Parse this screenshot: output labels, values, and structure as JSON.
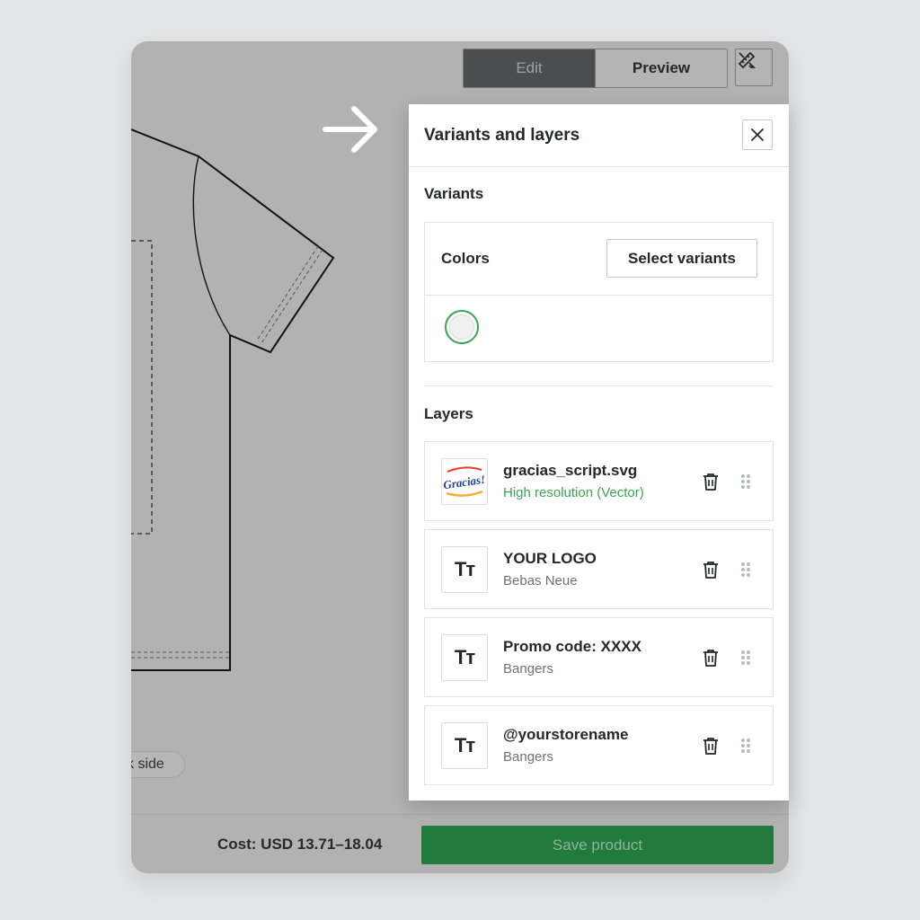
{
  "toolbar": {
    "edit_label": "Edit",
    "preview_label": "Preview",
    "tool_icon": "ruler-pencil-icon"
  },
  "canvas": {
    "side_toggle_label": "k side"
  },
  "footer": {
    "cost_label": "Cost: USD 13.71–18.04",
    "save_label": "Save product"
  },
  "panel": {
    "title": "Variants and layers",
    "variants": {
      "heading": "Variants",
      "colors_label": "Colors",
      "select_button": "Select variants",
      "selected_color": "#f1f1f1"
    },
    "layers": {
      "heading": "Layers",
      "items": [
        {
          "name": "gracias_script.svg",
          "sub": "High resolution (Vector)",
          "type": "image",
          "thumb_text": "Gracias!"
        },
        {
          "name": "YOUR LOGO",
          "sub": "Bebas Neue",
          "type": "text",
          "thumb_text": "Tт"
        },
        {
          "name": "Promo code: XXXX",
          "sub": "Bangers",
          "type": "text",
          "thumb_text": "Tт"
        },
        {
          "name": "@yourstorename",
          "sub": "Bangers",
          "type": "text",
          "thumb_text": "Tт"
        }
      ]
    }
  },
  "colors": {
    "accent_green": "#227a3c",
    "status_green": "#3aa655",
    "canvas_gray": "#b2b2b2"
  }
}
